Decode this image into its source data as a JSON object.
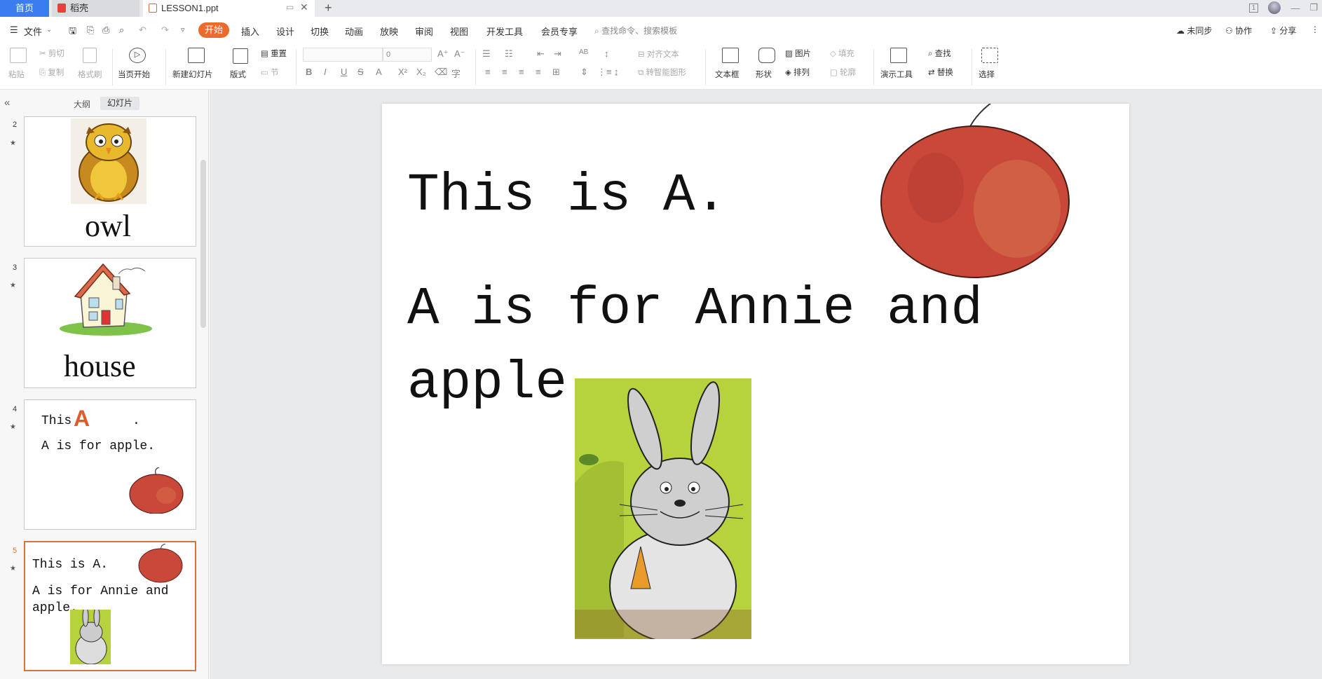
{
  "tabs": {
    "home": "首页",
    "straw": "稻壳",
    "doc": "LESSON1.ppt"
  },
  "menu": {
    "file": "文件",
    "items": [
      "开始",
      "插入",
      "设计",
      "切换",
      "动画",
      "放映",
      "审阅",
      "视图",
      "开发工具",
      "会员专享"
    ],
    "search_placeholder": "查找命令、搜索模板",
    "sync": "未同步",
    "collab": "协作",
    "share": "分享"
  },
  "ribbon": {
    "paste": "粘贴",
    "cut": "剪切",
    "copy": "复制",
    "format_painter": "格式刷",
    "start_from_current": "当页开始",
    "new_slide": "新建幻灯片",
    "layout": "版式",
    "reset": "重置",
    "section": "节",
    "font_size": "0",
    "align_text": "对齐文本",
    "smart_art": "转智能图形",
    "textbox": "文本框",
    "shape": "形状",
    "picture": "图片",
    "arrange": "排列",
    "fill": "填充",
    "outline": "轮廓",
    "presentation_tools": "演示工具",
    "find": "查找",
    "replace": "替换",
    "select": "选择"
  },
  "panel": {
    "outline_tab": "大纲",
    "slides_tab": "幻灯片"
  },
  "thumbnails": [
    {
      "num": "2",
      "word": "owl"
    },
    {
      "num": "3",
      "word": "house"
    },
    {
      "num": "4",
      "line1": "This",
      "letter": "A",
      "dot": ".",
      "line2": "A is for apple."
    },
    {
      "num": "5",
      "line1": "This is A.",
      "line2": "A is for Annie and",
      "line3": "apple."
    }
  ],
  "slide": {
    "line1": "This is A.",
    "line2": "A is for Annie and",
    "line3": "apple."
  },
  "colors": {
    "accent": "#ed6a2d",
    "home_tab": "#3b7cf0",
    "selected_border": "#d7763c",
    "apple": "#c9483a"
  },
  "icons": [
    "search-icon",
    "save-icon",
    "undo-icon",
    "redo-icon",
    "print-icon",
    "play-icon",
    "cloud-icon",
    "share-icon",
    "apple-image",
    "rabbit-image",
    "owl-image",
    "house-image"
  ]
}
